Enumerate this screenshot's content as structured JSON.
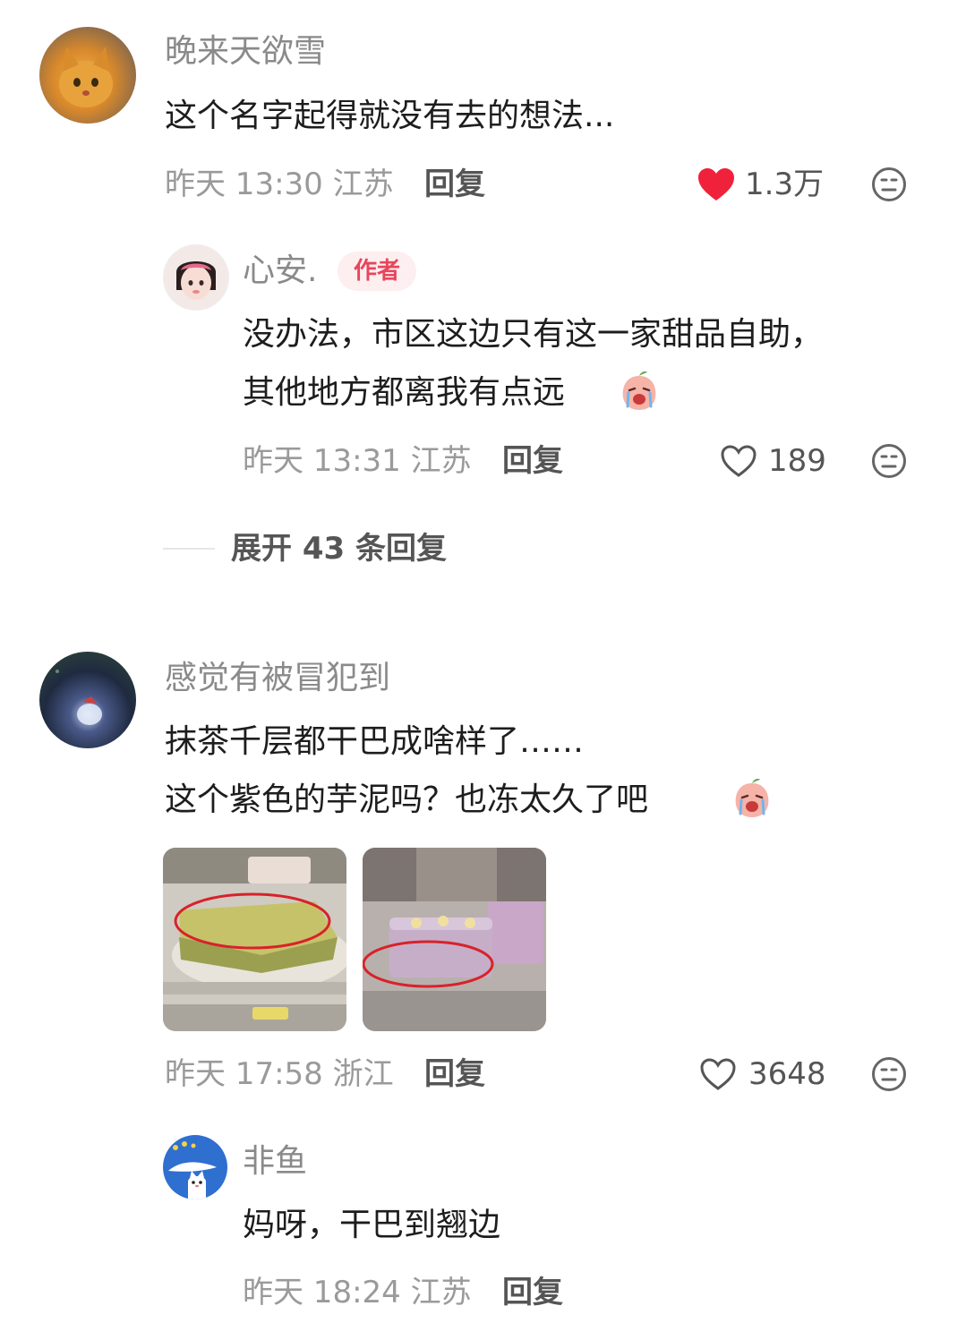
{
  "comments": [
    {
      "author": "晚来天欲雪",
      "text_lines": [
        "这个名字起得就没有去的想法..."
      ],
      "meta": "昨天 13:30 江苏",
      "reply_label": "回复",
      "likes": "1.3万",
      "liked": true,
      "avatar_icon": "orange-cat-avatar",
      "replies": [
        {
          "author": "心安.",
          "author_tag": "作者",
          "text_lines": [
            "没办法，市区这边只有这一家甜品自助，",
            "其他地方都离我有点远"
          ],
          "emoji_icon": "crying-peach-emoji",
          "meta": "昨天 13:31 江苏",
          "reply_label": "回复",
          "likes": "189",
          "avatar_icon": "girl-avatar"
        }
      ],
      "expand_label": "展开 43 条回复"
    },
    {
      "author": "感觉有被冒犯到",
      "text_lines": [
        "抹茶千层都干巴成啥样了……",
        "这个紫色的芋泥吗？也冻太久了吧"
      ],
      "emoji_icon": "crying-peach-emoji",
      "images": [
        "matcha-crepe-cake-photo",
        "purple-taro-cake-photo"
      ],
      "meta": "昨天 17:58 浙江",
      "reply_label": "回复",
      "likes": "3648",
      "avatar_icon": "night-ground-avatar",
      "replies": [
        {
          "author": "非鱼",
          "text_lines": [
            "妈呀，干巴到翘边"
          ],
          "meta": "昨天 18:24 江苏",
          "reply_label": "回复",
          "avatar_icon": "blue-cat-avatar"
        }
      ]
    }
  ],
  "colors": {
    "liked_heart": "#f0213a",
    "author_tag_bg": "#fdeef0",
    "author_tag_text": "#e5475b",
    "name_gray": "#8a8a8a",
    "meta_gray": "#9a9a9a"
  }
}
